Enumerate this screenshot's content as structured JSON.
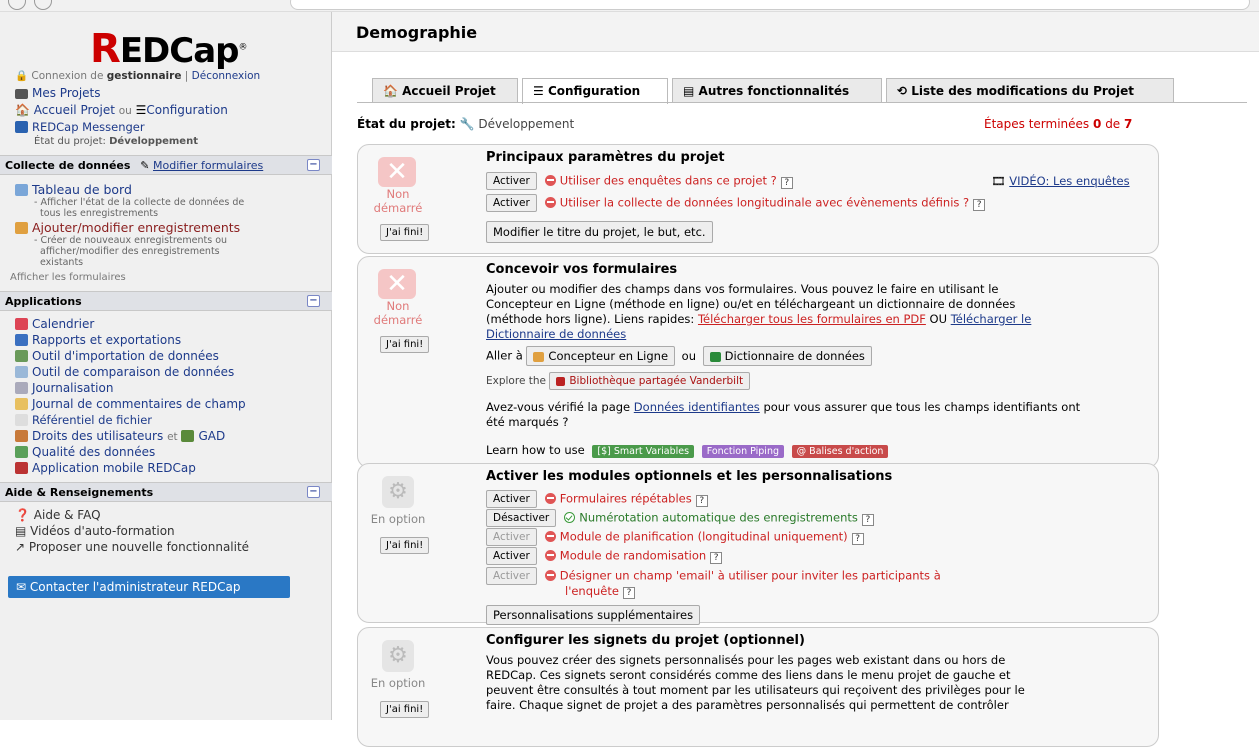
{
  "app": {
    "logo": "REDCap"
  },
  "sidebar": {
    "login_prefix": "Connexion de",
    "login_user": "gestionnaire",
    "logout": "Déconnexion",
    "my_projects": "Mes Projets",
    "home_project": "Accueil Projet",
    "ou": "ou",
    "configuration": "Configuration",
    "messenger": "REDCap Messenger",
    "project_state_label": "État du projet:",
    "project_state_value": "Développement",
    "sections": {
      "collect": {
        "title": "Collecte de données",
        "modify_forms": "Modifier formulaires"
      },
      "applications": {
        "title": "Applications"
      },
      "help": {
        "title": "Aide & Renseignements"
      }
    },
    "collect_items": [
      {
        "label": "Tableau de bord",
        "desc1": "- Afficher l'état de la collecte de données de",
        "desc2": "tous les enregistrements"
      },
      {
        "label": "Ajouter/modifier enregistrements",
        "desc1": "- Créer de nouveaux enregistrements ou",
        "desc2": "afficher/modifier des enregistrements",
        "desc3": "existants"
      }
    ],
    "show_forms": "Afficher les formulaires",
    "app_items": [
      {
        "label": "Calendrier",
        "icon": "calendar-icon"
      },
      {
        "label": "Rapports et exportations",
        "icon": "reports-icon"
      },
      {
        "label": "Outil d'importation de données",
        "icon": "import-icon"
      },
      {
        "label": "Outil de comparaison de données",
        "icon": "compare-icon"
      },
      {
        "label": "Journalisation",
        "icon": "log-icon"
      },
      {
        "label": "Journal de commentaires de champ",
        "icon": "comment-icon"
      },
      {
        "label": "Référentiel de fichier",
        "icon": "file-icon"
      },
      {
        "label": "Droits des utilisateurs",
        "icon": "users-icon",
        "extra_et": "et",
        "extra": "GAD"
      },
      {
        "label": "Qualité des données",
        "icon": "quality-icon"
      },
      {
        "label": "Application mobile REDCap",
        "icon": "mobile-icon"
      }
    ],
    "help_items": [
      {
        "label": "Aide & FAQ"
      },
      {
        "label": "Vidéos d'auto-formation"
      },
      {
        "label": "Proposer une nouvelle fonctionnalité"
      }
    ],
    "contact_admin": "Contacter l'administrateur REDCap"
  },
  "main": {
    "page_title": "Demographie",
    "tabs": [
      {
        "label": "Accueil Projet"
      },
      {
        "label": "Configuration"
      },
      {
        "label": "Autres fonctionnalités"
      },
      {
        "label": "Liste des modifications du Projet"
      }
    ],
    "status_label": "État du projet:",
    "status_value": "Développement",
    "steps_prefix": "Étapes terminées",
    "steps_done": "0",
    "steps_de": "de",
    "steps_total": "7",
    "done_btn": "J'ai fini!",
    "status_not_started_1": "Non",
    "status_not_started_2": "démarré",
    "status_optional": "En option",
    "q": "?",
    "box1": {
      "title": "Principaux paramètres du projet",
      "enable": "Activer",
      "row1": "Utiliser des enquêtes dans ce projet ?",
      "video": "VIDÉO: Les enquêtes",
      "row2": "Utiliser la collecte de données longitudinale avec évènements définis ?",
      "modify_btn": "Modifier le titre du projet, le but, etc."
    },
    "box2": {
      "title": "Concevoir vos formulaires",
      "p1": "Ajouter ou modifier des champs dans vos formulaires. Vous pouvez le faire en utilisant le",
      "p2": "Concepteur en Ligne (méthode en ligne) ou/et en téléchargeant un dictionnaire de données",
      "p3": "(méthode hors ligne). Liens rapides:",
      "link_pdf": "Télécharger tous les formulaires en PDF",
      "ou": "OU",
      "link_dict1": "Télécharger le",
      "link_dict2": "Dictionnaire de données",
      "goto": "Aller à",
      "designer_btn": "Concepteur en Ligne",
      "dict_btn": "Dictionnaire de données",
      "explore": "Explore the",
      "library_btn": "Bibliothèque partagée Vanderbilt",
      "verify1": "Avez-vous vérifié la page",
      "verify_link": "Données identifiantes",
      "verify2": "pour vous assurer que tous les champs identifiants ont",
      "verify3": "été marqués ?",
      "learn": "Learn how to use",
      "tag1": "[$] Smart Variables",
      "tag2": "Fonction Piping",
      "tag3": "@ Balises d'action"
    },
    "box3": {
      "title": "Activer les modules optionnels et les personnalisations",
      "enable": "Activer",
      "disable": "Désactiver",
      "r1": "Formulaires répétables",
      "r2": "Numérotation automatique des enregistrements",
      "r3": "Module de planification (longitudinal uniquement)",
      "r4": "Module de randomisation",
      "r5a": "Désigner un champ 'email' à utiliser pour inviter les participants à",
      "r5b": "l'enquête",
      "custom_btn": "Personnalisations supplémentaires"
    },
    "box4": {
      "title": "Configurer les signets du projet (optionnel)",
      "p1": "Vous pouvez créer des signets personnalisés pour les pages web existant dans ou hors de",
      "p2": "REDCap. Ces signets seront considérés comme des liens dans le menu projet de gauche et",
      "p3": "peuvent être consultés à tout moment par les utilisateurs qui reçoivent des privilèges pour le",
      "p4": "faire. Chaque signet de projet a des paramètres personnalisés qui permettent de contrôler"
    }
  }
}
